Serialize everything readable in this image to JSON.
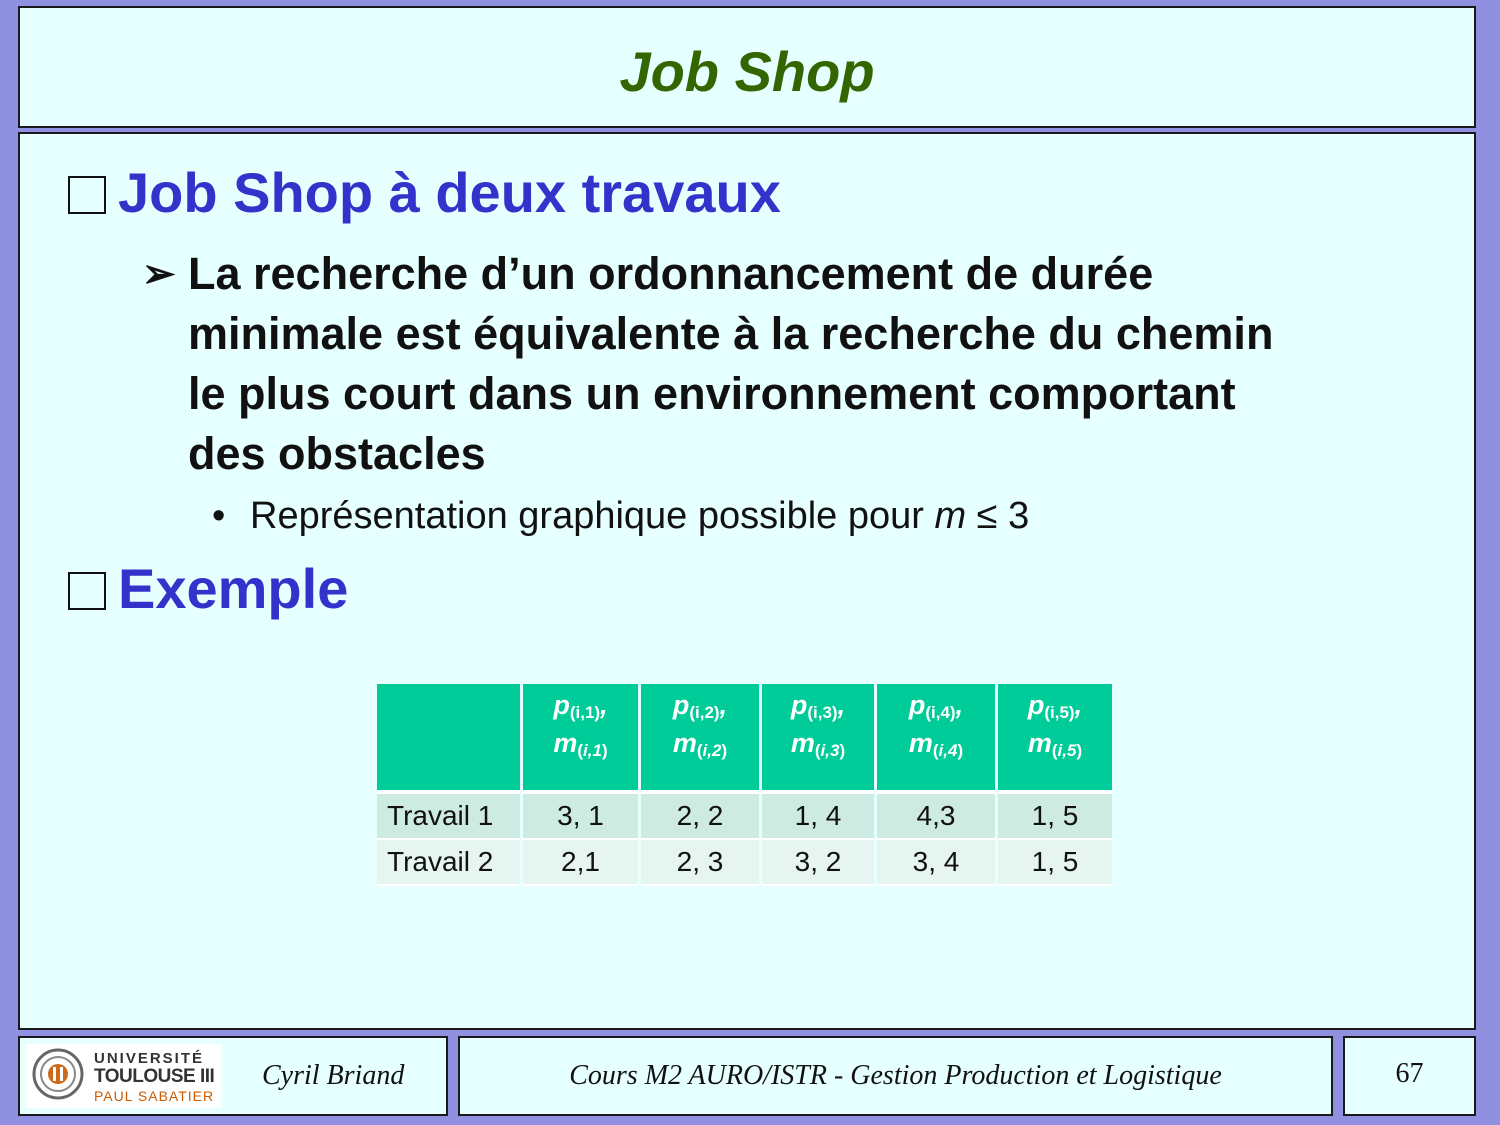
{
  "slide": {
    "title": "Job Shop",
    "heading1": "Job Shop à deux travaux",
    "bullet_main": "La recherche d’un ordonnancement de durée minimale est équivalente à la recherche du chemin le plus court dans un environnement comportant des obstacles",
    "sub_bullet_prefix": "Représentation graphique possible pour ",
    "sub_bullet_var": "m",
    "sub_bullet_suffix": " ≤ 3",
    "heading2": "Exemple"
  },
  "table": {
    "columns": [
      {
        "p": "p",
        "p_sub": "(i,1)",
        "m": "m",
        "m_sub_open": "(",
        "m_sub_i": "i",
        "m_sub_rest": ",1",
        "m_sub_close": ")"
      },
      {
        "p": "p",
        "p_sub": "(i,2)",
        "m": "m",
        "m_sub_open": "(",
        "m_sub_i": "i",
        "m_sub_rest": ",2",
        "m_sub_close": ")"
      },
      {
        "p": "p",
        "p_sub": "(i,3)",
        "m": "m",
        "m_sub_open": "(",
        "m_sub_i": "i",
        "m_sub_rest": ",3",
        "m_sub_close": ")"
      },
      {
        "p": "p",
        "p_sub": "(i,4)",
        "m": "m",
        "m_sub_open": "(",
        "m_sub_i": "i",
        "m_sub_rest": ",4",
        "m_sub_close": ")"
      },
      {
        "p": "p",
        "p_sub": "(i,5)",
        "m": "m",
        "m_sub_open": "(",
        "m_sub_i": "i",
        "m_sub_rest": ",5",
        "m_sub_close": ")"
      }
    ],
    "rows": [
      {
        "label": "Travail 1",
        "cells": [
          "3, 1",
          "2, 2",
          "1, 4",
          "4,3",
          "1, 5"
        ]
      },
      {
        "label": "Travail 2",
        "cells": [
          "2,1",
          "2, 3",
          "3, 2",
          "3, 4",
          "1, 5"
        ]
      }
    ]
  },
  "footer": {
    "logo_line1": "UNIVERSITÉ",
    "logo_line2": "TOULOUSE III",
    "logo_line3": "PAUL SABATIER",
    "author": "Cyril Briand",
    "course": "Cours M2 AURO/ISTR - Gestion Production et Logistique",
    "page_number": "67"
  },
  "colors": {
    "background": "#9090e0",
    "panel": "#e6ffff",
    "title": "#336600",
    "heading": "#3333cc",
    "table_header": "#00cc99"
  }
}
